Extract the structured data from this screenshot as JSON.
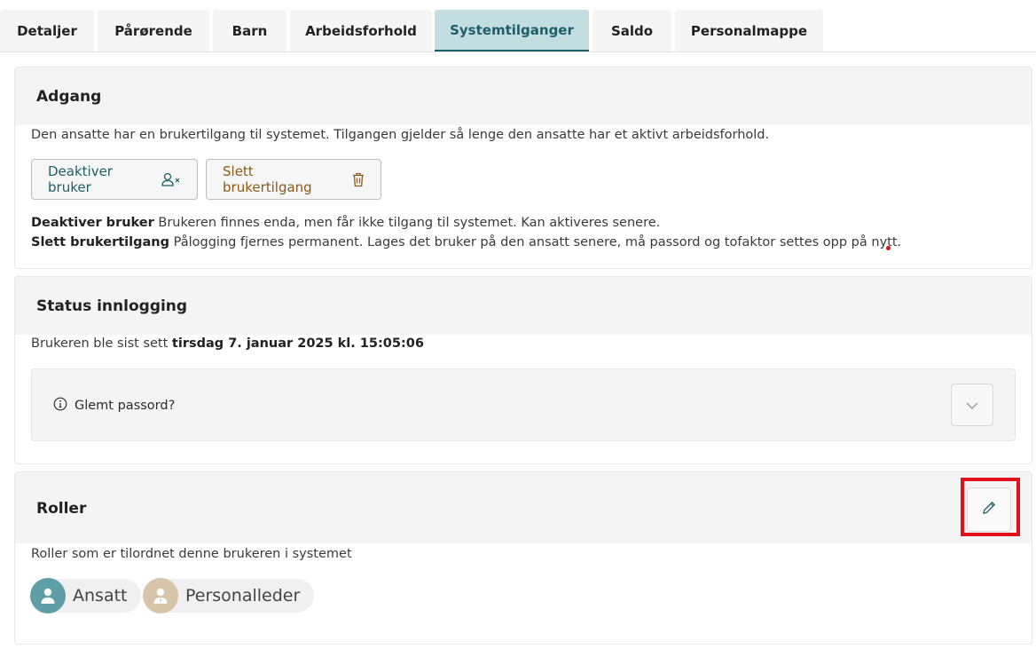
{
  "tabs": [
    {
      "label": "Detaljer",
      "active": false
    },
    {
      "label": "Pårørende",
      "active": false
    },
    {
      "label": "Barn",
      "active": false
    },
    {
      "label": "Arbeidsforhold",
      "active": false
    },
    {
      "label": "Systemtilganger",
      "active": true
    },
    {
      "label": "Saldo",
      "active": false
    },
    {
      "label": "Personalmappe",
      "active": false
    }
  ],
  "access": {
    "title": "Adgang",
    "description": "Den ansatte har en brukertilgang til systemet. Tilgangen gjelder så lenge den ansatte har et aktivt arbeidsforhold.",
    "deactivate_label": "Deaktiver bruker",
    "delete_label": "Slett brukertilgang",
    "deactivate_term": "Deaktiver bruker",
    "deactivate_help": "Brukeren finnes enda, men får ikke tilgang til systemet. Kan aktiveres senere.",
    "delete_term": "Slett brukertilgang",
    "delete_help": "Pålogging fjernes permanent. Lages det bruker på den ansatt senere, må passord og tofaktor settes opp på nytt."
  },
  "login_status": {
    "title": "Status innlogging",
    "last_seen_prefix": "Brukeren ble sist sett",
    "last_seen_value": "tirsdag 7. januar 2025 kl. 15:05:06",
    "forgot_password_label": "Glemt passord?"
  },
  "roles": {
    "title": "Roller",
    "description": "Roller som er tilordnet denne brukeren i systemet",
    "items": [
      {
        "label": "Ansatt",
        "color": "#5e9ea6"
      },
      {
        "label": "Personalleder",
        "color": "#d8c4a8"
      }
    ]
  },
  "colors": {
    "accent": "#1c5f6b",
    "active_tab_bg": "#c4dde1",
    "highlight": "#e0111b"
  }
}
